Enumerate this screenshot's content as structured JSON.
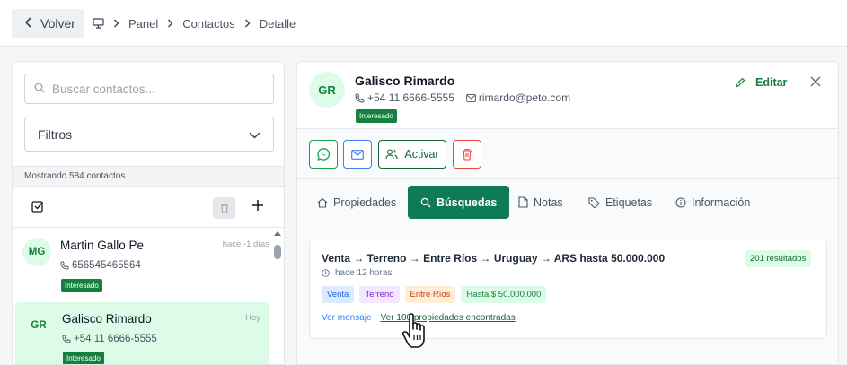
{
  "topbar": {
    "back_label": "Volver",
    "breadcrumb": [
      "Panel",
      "Contactos",
      "Detalle"
    ]
  },
  "sidebar": {
    "search_placeholder": "Buscar contactos...",
    "filters_label": "Filtros",
    "count_text": "Mostrando 584 contactos",
    "contacts": [
      {
        "initials": "MG",
        "name": "Martin Gallo Pe",
        "phone": "656545465564",
        "status": "Interesado",
        "time": "hace -1 días"
      },
      {
        "initials": "GR",
        "name": "Galisco Rimardo",
        "phone": "+54 11 6666-5555",
        "status": "Interesado",
        "time": "Hoy"
      }
    ]
  },
  "detail": {
    "initials": "GR",
    "name": "Galisco Rimardo",
    "phone": "+54 11 6666-5555",
    "email": "rimardo@peto.com",
    "status": "Interesado",
    "edit_label": "Editar",
    "activate_label": "Activar",
    "tabs": [
      "Propiedades",
      "Búsquedas",
      "Notas",
      "Etiquetas",
      "Información"
    ],
    "active_tab": "Búsquedas",
    "search_card": {
      "title": "Venta → Terreno → Entre Ríos → Uruguay → ARS hasta 50.000.000",
      "results": "201 resultados",
      "since": "hace 12 horas",
      "chips": [
        "Venta",
        "Terreno",
        "Entre Ríos",
        "Hasta $ 50.000.000"
      ],
      "link_message": "Ver mensaje",
      "link_properties": "Ver 100 propiedades encontradas"
    }
  },
  "colors": {
    "brand_green": "#0f7a58",
    "badge_green": "#15803d",
    "whatsapp_green": "#16a34a",
    "mail_blue": "#3b82f6",
    "delete_red": "#ef4444"
  }
}
